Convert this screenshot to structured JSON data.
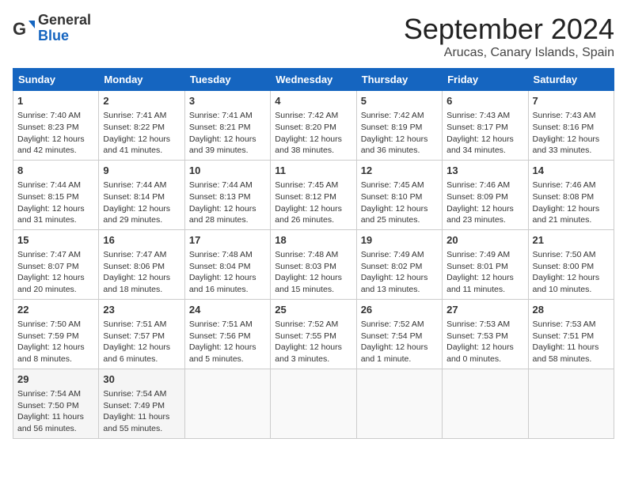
{
  "header": {
    "logo_general": "General",
    "logo_blue": "Blue",
    "month_title": "September 2024",
    "location": "Arucas, Canary Islands, Spain"
  },
  "calendar": {
    "days_of_week": [
      "Sunday",
      "Monday",
      "Tuesday",
      "Wednesday",
      "Thursday",
      "Friday",
      "Saturday"
    ],
    "weeks": [
      [
        {
          "day": "1",
          "info": "Sunrise: 7:40 AM\nSunset: 8:23 PM\nDaylight: 12 hours and 42 minutes."
        },
        {
          "day": "2",
          "info": "Sunrise: 7:41 AM\nSunset: 8:22 PM\nDaylight: 12 hours and 41 minutes."
        },
        {
          "day": "3",
          "info": "Sunrise: 7:41 AM\nSunset: 8:21 PM\nDaylight: 12 hours and 39 minutes."
        },
        {
          "day": "4",
          "info": "Sunrise: 7:42 AM\nSunset: 8:20 PM\nDaylight: 12 hours and 38 minutes."
        },
        {
          "day": "5",
          "info": "Sunrise: 7:42 AM\nSunset: 8:19 PM\nDaylight: 12 hours and 36 minutes."
        },
        {
          "day": "6",
          "info": "Sunrise: 7:43 AM\nSunset: 8:17 PM\nDaylight: 12 hours and 34 minutes."
        },
        {
          "day": "7",
          "info": "Sunrise: 7:43 AM\nSunset: 8:16 PM\nDaylight: 12 hours and 33 minutes."
        }
      ],
      [
        {
          "day": "8",
          "info": "Sunrise: 7:44 AM\nSunset: 8:15 PM\nDaylight: 12 hours and 31 minutes."
        },
        {
          "day": "9",
          "info": "Sunrise: 7:44 AM\nSunset: 8:14 PM\nDaylight: 12 hours and 29 minutes."
        },
        {
          "day": "10",
          "info": "Sunrise: 7:44 AM\nSunset: 8:13 PM\nDaylight: 12 hours and 28 minutes."
        },
        {
          "day": "11",
          "info": "Sunrise: 7:45 AM\nSunset: 8:12 PM\nDaylight: 12 hours and 26 minutes."
        },
        {
          "day": "12",
          "info": "Sunrise: 7:45 AM\nSunset: 8:10 PM\nDaylight: 12 hours and 25 minutes."
        },
        {
          "day": "13",
          "info": "Sunrise: 7:46 AM\nSunset: 8:09 PM\nDaylight: 12 hours and 23 minutes."
        },
        {
          "day": "14",
          "info": "Sunrise: 7:46 AM\nSunset: 8:08 PM\nDaylight: 12 hours and 21 minutes."
        }
      ],
      [
        {
          "day": "15",
          "info": "Sunrise: 7:47 AM\nSunset: 8:07 PM\nDaylight: 12 hours and 20 minutes."
        },
        {
          "day": "16",
          "info": "Sunrise: 7:47 AM\nSunset: 8:06 PM\nDaylight: 12 hours and 18 minutes."
        },
        {
          "day": "17",
          "info": "Sunrise: 7:48 AM\nSunset: 8:04 PM\nDaylight: 12 hours and 16 minutes."
        },
        {
          "day": "18",
          "info": "Sunrise: 7:48 AM\nSunset: 8:03 PM\nDaylight: 12 hours and 15 minutes."
        },
        {
          "day": "19",
          "info": "Sunrise: 7:49 AM\nSunset: 8:02 PM\nDaylight: 12 hours and 13 minutes."
        },
        {
          "day": "20",
          "info": "Sunrise: 7:49 AM\nSunset: 8:01 PM\nDaylight: 12 hours and 11 minutes."
        },
        {
          "day": "21",
          "info": "Sunrise: 7:50 AM\nSunset: 8:00 PM\nDaylight: 12 hours and 10 minutes."
        }
      ],
      [
        {
          "day": "22",
          "info": "Sunrise: 7:50 AM\nSunset: 7:59 PM\nDaylight: 12 hours and 8 minutes."
        },
        {
          "day": "23",
          "info": "Sunrise: 7:51 AM\nSunset: 7:57 PM\nDaylight: 12 hours and 6 minutes."
        },
        {
          "day": "24",
          "info": "Sunrise: 7:51 AM\nSunset: 7:56 PM\nDaylight: 12 hours and 5 minutes."
        },
        {
          "day": "25",
          "info": "Sunrise: 7:52 AM\nSunset: 7:55 PM\nDaylight: 12 hours and 3 minutes."
        },
        {
          "day": "26",
          "info": "Sunrise: 7:52 AM\nSunset: 7:54 PM\nDaylight: 12 hours and 1 minute."
        },
        {
          "day": "27",
          "info": "Sunrise: 7:53 AM\nSunset: 7:53 PM\nDaylight: 12 hours and 0 minutes."
        },
        {
          "day": "28",
          "info": "Sunrise: 7:53 AM\nSunset: 7:51 PM\nDaylight: 11 hours and 58 minutes."
        }
      ],
      [
        {
          "day": "29",
          "info": "Sunrise: 7:54 AM\nSunset: 7:50 PM\nDaylight: 11 hours and 56 minutes."
        },
        {
          "day": "30",
          "info": "Sunrise: 7:54 AM\nSunset: 7:49 PM\nDaylight: 11 hours and 55 minutes."
        },
        {
          "day": "",
          "info": ""
        },
        {
          "day": "",
          "info": ""
        },
        {
          "day": "",
          "info": ""
        },
        {
          "day": "",
          "info": ""
        },
        {
          "day": "",
          "info": ""
        }
      ]
    ]
  }
}
